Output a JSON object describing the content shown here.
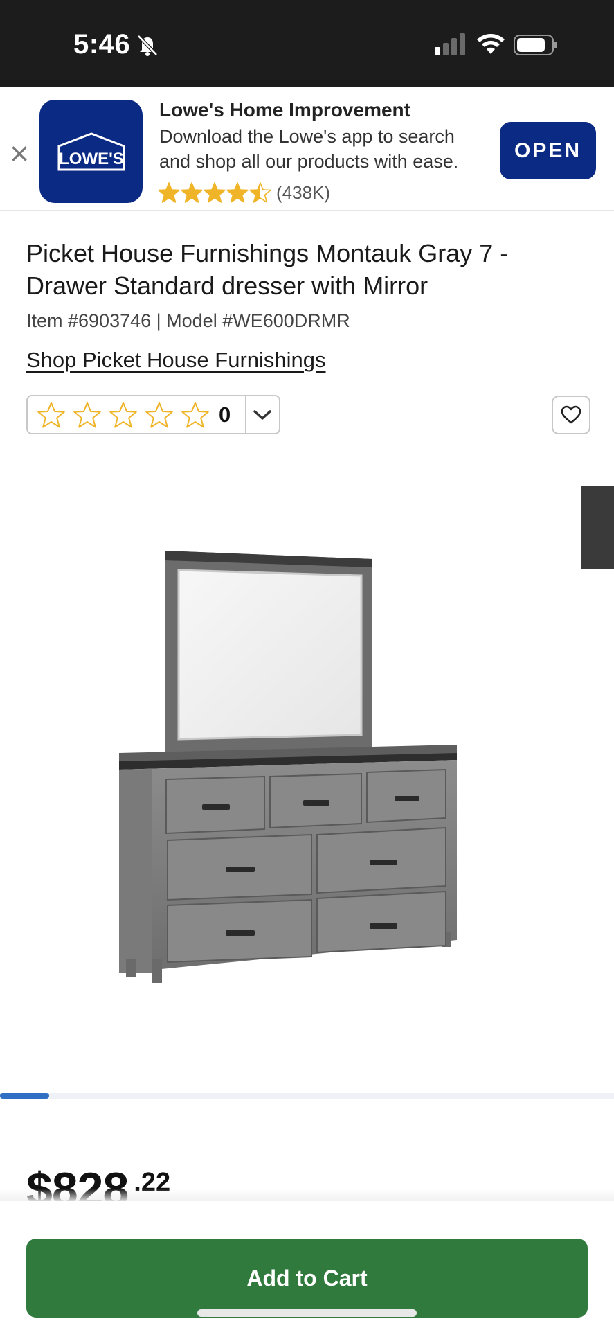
{
  "status_bar": {
    "time": "5:46"
  },
  "app_banner": {
    "close_glyph": "×",
    "logo_text": "LOWE'S",
    "title": "Lowe's Home Improvement",
    "description": "Download the Lowe's app to search and shop all our products with ease.",
    "rating_value": 4.5,
    "rating_count": "(438K)",
    "open_label": "OPEN",
    "brand_color": "#0b2a84",
    "star_color": "#f0b428"
  },
  "product": {
    "title": "Picket House Furnishings Montauk Gray 7 - Drawer Standard dresser with Mirror",
    "item_info": "Item #6903746 |  Model #WE600DRMR",
    "shop_link": "Shop Picket House Furnishings",
    "rating_count": "0",
    "price_dollars": "$828",
    "price_cents": ".22"
  },
  "gallery": {
    "progress_fraction": 0.08,
    "progress_color": "#2f6fc4"
  },
  "actions": {
    "add_to_cart_label": "Add to Cart",
    "cart_color": "#2f7a3c"
  },
  "icons": [
    "bell-slash-icon",
    "signal-icon",
    "wifi-icon",
    "battery-icon",
    "close-icon",
    "star-icon",
    "chevron-down-icon",
    "heart-icon"
  ]
}
